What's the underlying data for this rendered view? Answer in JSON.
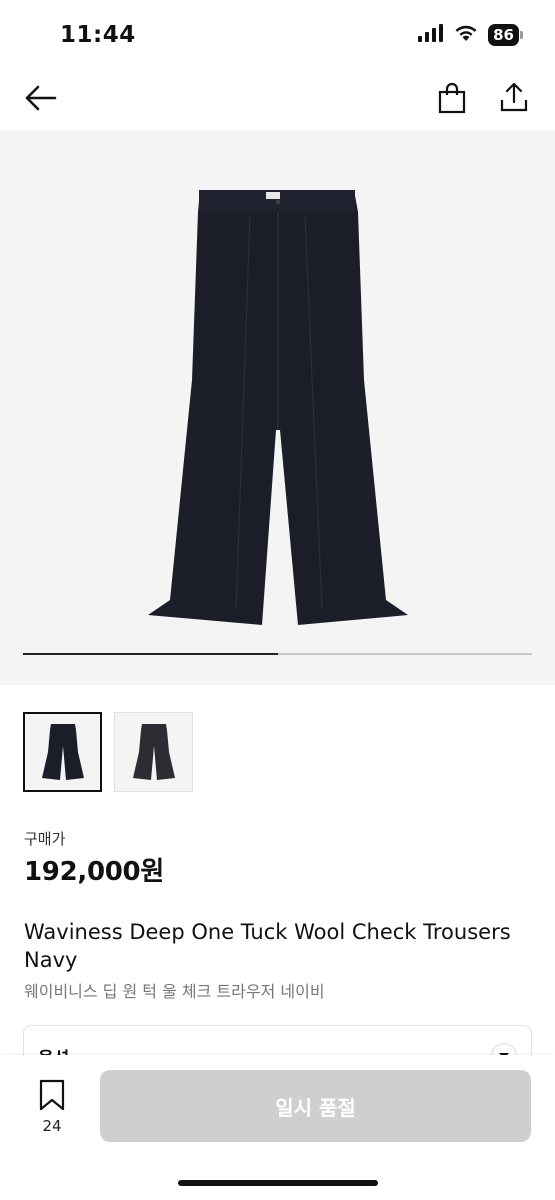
{
  "status_bar": {
    "time": "11:44",
    "battery": "86",
    "icons": [
      "cellular-signal-icon",
      "wifi-icon",
      "battery-icon"
    ]
  },
  "nav": {
    "icons": [
      "back-arrow-icon",
      "shopping-bag-icon",
      "share-icon"
    ]
  },
  "gallery": {
    "progress": 0.5,
    "thumbnails": [
      {
        "name": "thumbnail-1",
        "selected": true
      },
      {
        "name": "thumbnail-2",
        "selected": false
      }
    ]
  },
  "product": {
    "price_label": "구매가",
    "price": "192,000원",
    "name_en": "Waviness Deep One Tuck Wool Check Trousers Navy",
    "name_ko": "웨이비니스 딥 원 턱 울 체크 트라우저 네이비"
  },
  "option": {
    "label": "옵션"
  },
  "bottom_bar": {
    "bookmark_count": "24",
    "soldout_label": "일시 품절"
  },
  "colors": {
    "accent": "#111111",
    "disabled_button": "#cfcfcf",
    "image_background": "#f4f4f4",
    "trousers": "#1b1e29"
  }
}
